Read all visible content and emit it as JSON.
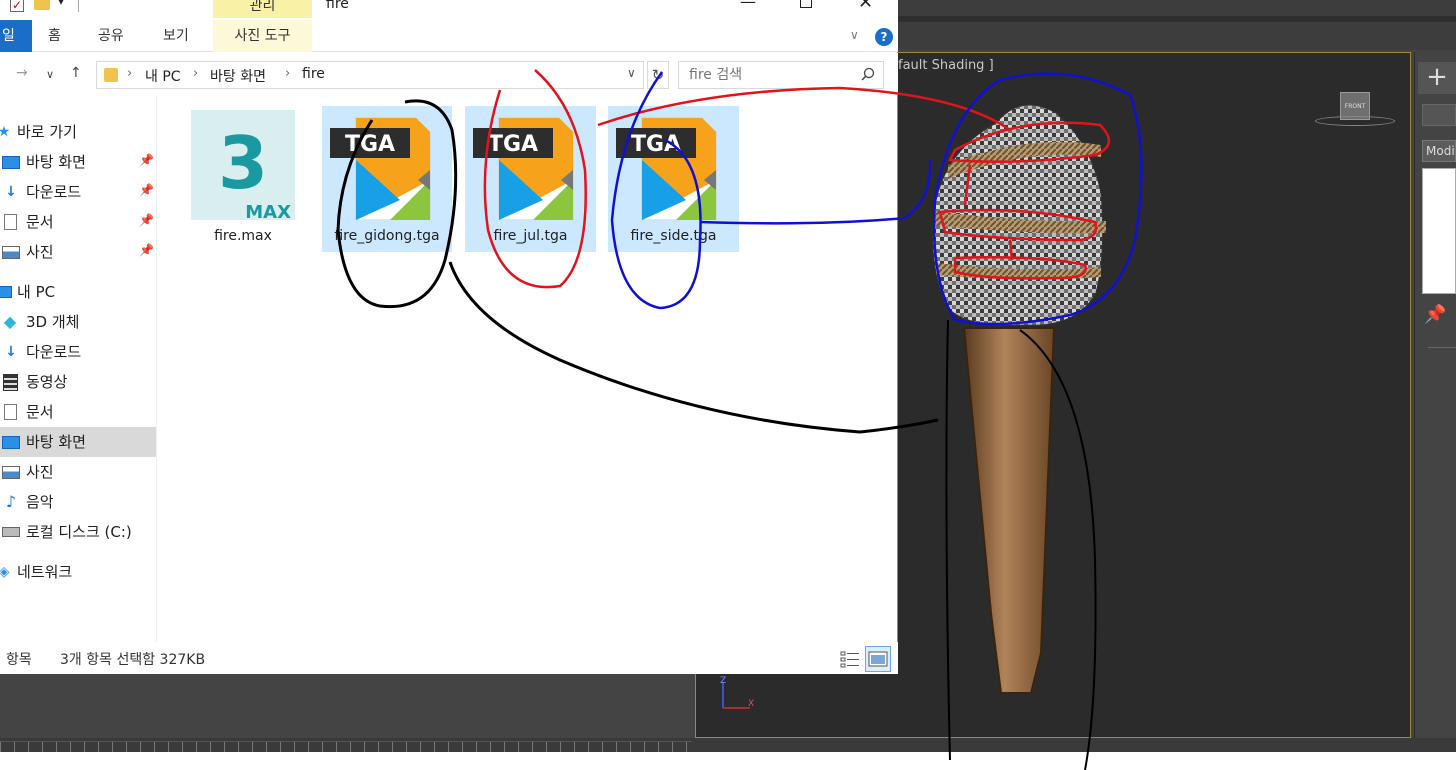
{
  "explorer": {
    "window_title": "fire",
    "contextual_tab_header": "관리",
    "ribbon_tabs": {
      "file": "일",
      "home": "홈",
      "share": "공유",
      "view": "보기",
      "picture_tools": "사진 도구"
    },
    "breadcrumb": [
      "내 PC",
      "바탕 화면",
      "fire"
    ],
    "search": {
      "placeholder": "fire 검색"
    },
    "sidebar": [
      {
        "label": "바로 가기",
        "icon": "star-icon",
        "pinned": false
      },
      {
        "label": "바탕 화면",
        "icon": "desktop-icon",
        "pinned": true
      },
      {
        "label": "다운로드",
        "icon": "download-icon",
        "pinned": true
      },
      {
        "label": "문서",
        "icon": "document-icon",
        "pinned": true
      },
      {
        "label": "사진",
        "icon": "pictures-icon",
        "pinned": true
      },
      {
        "label": "내 PC",
        "icon": "computer-icon",
        "pinned": false
      },
      {
        "label": "3D 개체",
        "icon": "cube-icon",
        "pinned": false
      },
      {
        "label": "다운로드",
        "icon": "download-icon",
        "pinned": false
      },
      {
        "label": "동영상",
        "icon": "video-icon",
        "pinned": false
      },
      {
        "label": "문서",
        "icon": "document-icon",
        "pinned": false
      },
      {
        "label": "바탕 화면",
        "icon": "desktop-icon",
        "pinned": false,
        "selected": true
      },
      {
        "label": "사진",
        "icon": "pictures-icon",
        "pinned": false
      },
      {
        "label": "음악",
        "icon": "music-icon",
        "pinned": false
      },
      {
        "label": "로컬 디스크 (C:)",
        "icon": "drive-icon",
        "pinned": false
      },
      {
        "label": "네트워크",
        "icon": "network-icon",
        "pinned": false
      }
    ],
    "files": [
      {
        "name": "fire.max",
        "type": "max",
        "selected": false,
        "badge": "MAX",
        "glyph": "3"
      },
      {
        "name": "fire_gidong.tga",
        "type": "tga",
        "selected": true,
        "badge": "TGA"
      },
      {
        "name": "fire_jul.tga",
        "type": "tga",
        "selected": true,
        "badge": "TGA"
      },
      {
        "name": "fire_side.tga",
        "type": "tga",
        "selected": true,
        "badge": "TGA"
      }
    ],
    "status": {
      "item_count": "항목",
      "selection": "3개 항목 선택함 327KB"
    }
  },
  "max": {
    "viewport_label": "fault Shading ]",
    "viewcube_label": "FRONT",
    "axis_labels": {
      "z": "Z",
      "x": "X"
    },
    "command_panel": {
      "plus": "+",
      "modifier": "Modif"
    }
  },
  "colors": {
    "accent_blue": "#1a6ec7",
    "selection": "#cce8ff",
    "contextual_tab": "#f8f1a6",
    "annotation_red": "#e0141a",
    "annotation_blue": "#1010d0",
    "annotation_black": "#000000"
  }
}
